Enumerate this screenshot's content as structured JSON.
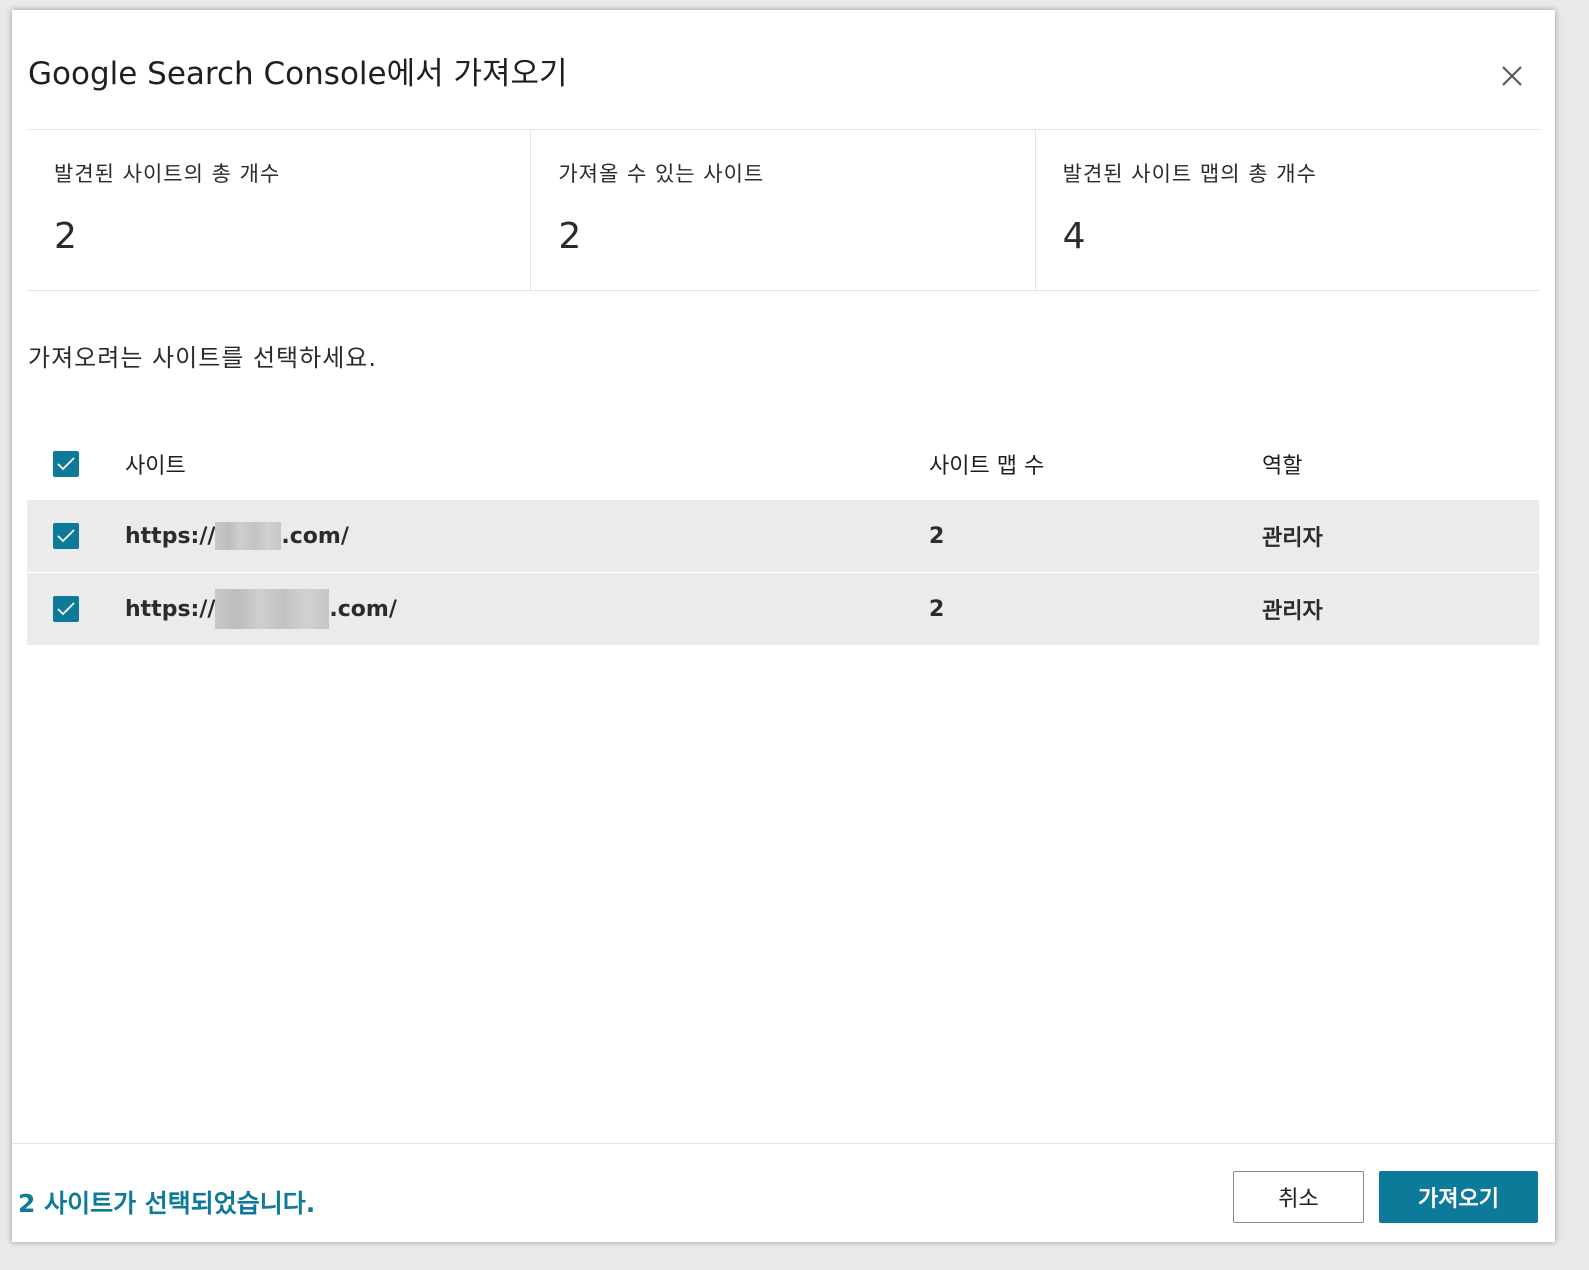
{
  "dialog": {
    "title": "Google Search Console에서 가져오기",
    "close_icon": "close-icon"
  },
  "stats": [
    {
      "label": "발견된 사이트의 총 개수",
      "value": "2"
    },
    {
      "label": "가져올 수 있는 사이트",
      "value": "2"
    },
    {
      "label": "발견된 사이트 맵의 총 개수",
      "value": "4"
    }
  ],
  "instruction": "가져오려는 사이트를 선택하세요.",
  "table": {
    "headers": {
      "site": "사이트",
      "sitemaps": "사이트 맵 수",
      "role": "역할"
    },
    "select_all_checked": true,
    "rows": [
      {
        "checked": true,
        "url_prefix": "https://",
        "url_suffix": ".com/",
        "sitemaps": "2",
        "role": "관리자"
      },
      {
        "checked": true,
        "url_prefix": "https://",
        "url_suffix": ".com/",
        "sitemaps": "2",
        "role": "관리자"
      }
    ]
  },
  "footer": {
    "selection_status": "2 사이트가 선택되었습니다.",
    "cancel_label": "취소",
    "import_label": "가져오기"
  },
  "colors": {
    "accent": "#0e7a99",
    "row_background": "#ebebeb"
  }
}
